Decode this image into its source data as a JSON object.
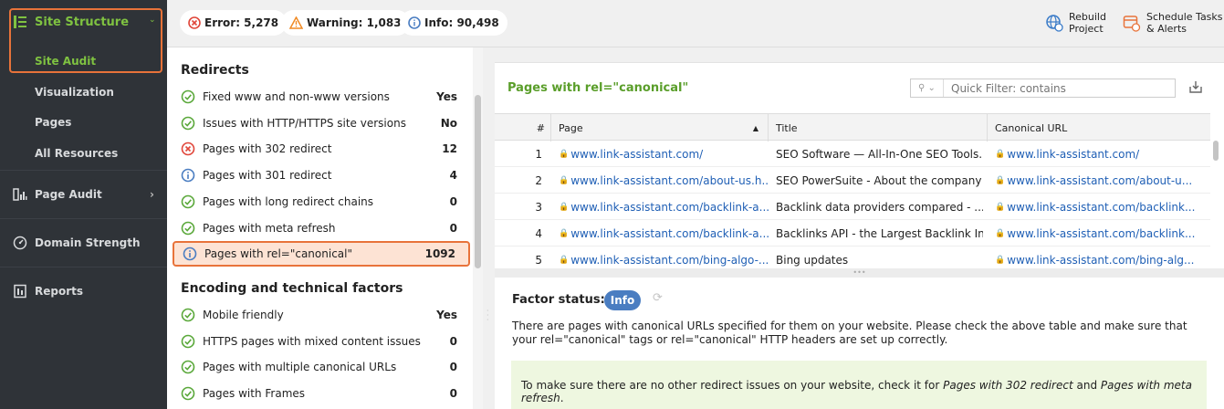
{
  "sidebar": {
    "site_structure": "Site Structure",
    "site_audit": "Site Audit",
    "visualization": "Visualization",
    "pages": "Pages",
    "all_resources": "All Resources",
    "page_audit": "Page Audit",
    "domain_strength": "Domain Strength",
    "reports": "Reports"
  },
  "topbar": {
    "error": "Error: 5,278",
    "warning": "Warning: 1,083",
    "info": "Info: 90,498",
    "rebuild_line1": "Rebuild",
    "rebuild_line2": "Project",
    "schedule_line1": "Schedule Tasks",
    "schedule_line2": "& Alerts"
  },
  "list": {
    "redirects_heading": "Redirects",
    "redirects": [
      {
        "label": "Fixed www and non-www versions",
        "value": "Yes",
        "status": "ok"
      },
      {
        "label": "Issues with HTTP/HTTPS site versions",
        "value": "No",
        "status": "ok"
      },
      {
        "label": "Pages with 302 redirect",
        "value": "12",
        "status": "error"
      },
      {
        "label": "Pages with 301 redirect",
        "value": "4",
        "status": "info"
      },
      {
        "label": "Pages with long redirect chains",
        "value": "0",
        "status": "ok"
      },
      {
        "label": "Pages with meta refresh",
        "value": "0",
        "status": "ok"
      },
      {
        "label": "Pages with rel=\"canonical\"",
        "value": "1092",
        "status": "info"
      }
    ],
    "encoding_heading": "Encoding and technical factors",
    "encoding": [
      {
        "label": "Mobile friendly",
        "value": "Yes",
        "status": "ok"
      },
      {
        "label": "HTTPS pages with mixed content issues",
        "value": "0",
        "status": "ok"
      },
      {
        "label": "Pages with multiple canonical URLs",
        "value": "0",
        "status": "ok"
      },
      {
        "label": "Pages with Frames",
        "value": "0",
        "status": "ok"
      }
    ]
  },
  "panel": {
    "title": "Pages with rel=\"canonical\"",
    "filter_placeholder": "Quick Filter: contains",
    "columns": {
      "num": "#",
      "page": "Page",
      "title": "Title",
      "canonical": "Canonical URL"
    },
    "rows": [
      {
        "num": "1",
        "page": "www.link-assistant.com/",
        "title": "SEO Software — All-In-One SEO Tools...",
        "canonical": "www.link-assistant.com/"
      },
      {
        "num": "2",
        "page": "www.link-assistant.com/about-us.h...",
        "title": "SEO PowerSuite - About the company ...",
        "canonical": "www.link-assistant.com/about-u..."
      },
      {
        "num": "3",
        "page": "www.link-assistant.com/backlink-a...",
        "title": "Backlink data providers compared - ...",
        "canonical": "www.link-assistant.com/backlink..."
      },
      {
        "num": "4",
        "page": "www.link-assistant.com/backlink-a...",
        "title": "Backlinks API - the Largest Backlink In...",
        "canonical": "www.link-assistant.com/backlink..."
      },
      {
        "num": "5",
        "page": "www.link-assistant.com/bing-algo-...",
        "title": "Bing updates",
        "canonical": "www.link-assistant.com/bing-alg..."
      }
    ]
  },
  "factor": {
    "label": "Factor status:",
    "badge": "Info",
    "description": "There are pages with canonical URLs specified for them on your website. Please check the above table and make sure that your rel=\"canonical\" tags or rel=\"canonical\" HTTP headers are set up correctly.",
    "tip_prefix": "To make sure there are no other redirect issues on your website, check it for ",
    "tip_link1": "Pages with 302 redirect",
    "tip_and": " and ",
    "tip_link2": "Pages with meta refresh",
    "tip_suffix": "."
  },
  "colors": {
    "accent_green": "#7fc241",
    "highlight": "#e8733a",
    "info_blue": "#4a7dc1",
    "error_red": "#e0463a",
    "warning_orange": "#f08a24"
  }
}
